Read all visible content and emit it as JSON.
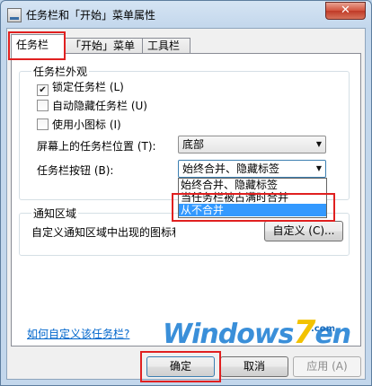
{
  "window": {
    "title": "任务栏和「开始」菜单属性",
    "close_label": "✕"
  },
  "tabs": [
    {
      "label": "任务栏",
      "active": true
    },
    {
      "label": "「开始」菜单",
      "active": false
    },
    {
      "label": "工具栏",
      "active": false
    }
  ],
  "appearance": {
    "group_title": "任务栏外观",
    "checkboxes": [
      {
        "label": "锁定任务栏 (L)",
        "checked": true
      },
      {
        "label": "自动隐藏任务栏 (U)",
        "checked": false
      },
      {
        "label": "使用小图标 (I)",
        "checked": false
      }
    ],
    "position_label": "屏幕上的任务栏位置 (T):",
    "position_value": "底部",
    "buttons_label": "任务栏按钮 (B):",
    "buttons_value": "始终合并、隐藏标签",
    "buttons_options": [
      "始终合并、隐藏标签",
      "当任务栏被占满时合并",
      "从不合并"
    ],
    "buttons_highlighted": "从不合并"
  },
  "notification": {
    "group_title": "通知区域",
    "text": "自定义通知区域中出现的图标和通知。",
    "customize_button": "自定义 (C)..."
  },
  "help_link": "如何自定义该任务栏?",
  "logo": {
    "text_main": "Windows",
    "text_seven": "7",
    "text_end": "en",
    "text_com": ".com"
  },
  "footer": {
    "ok": "确定",
    "cancel": "取消",
    "apply": "应用 (A)"
  }
}
